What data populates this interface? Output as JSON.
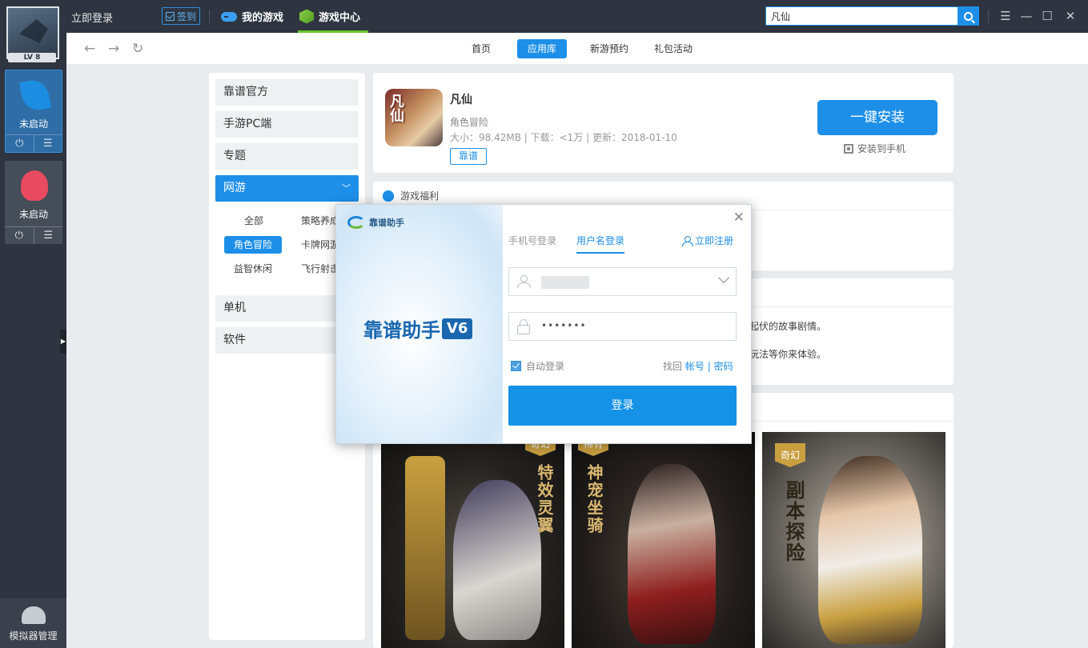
{
  "topbar": {
    "login_link": "立即登录",
    "signin_label": "签到",
    "tab_my_games": "我的游戏",
    "tab_game_center": "游戏中心",
    "search_value": "凡仙",
    "window_buttons": [
      "skin-icon",
      "menu-icon",
      "minimize-icon",
      "maximize-icon",
      "close-icon"
    ]
  },
  "dock": {
    "level": "LV 8",
    "emulators": [
      {
        "status": "未启动",
        "icon": "leaf-icon",
        "color": "#1c8de0"
      },
      {
        "status": "未启动",
        "icon": "bug-icon",
        "color": "#e84a5f"
      }
    ],
    "sim_manager": "模拟器管理"
  },
  "nav": {
    "tabs": [
      "首页",
      "应用库",
      "新游预约",
      "礼包活动"
    ],
    "active_tab": "应用库"
  },
  "categories": {
    "items": [
      "靠谱官方",
      "手游PC端",
      "专题",
      "网游",
      "单机",
      "软件"
    ],
    "active": "网游",
    "subcategories": [
      "全部",
      "策略养成",
      "角色冒险",
      "卡牌网游",
      "益智休闲",
      "飞行射击"
    ],
    "active_sub": "角色冒险"
  },
  "game": {
    "title": "凡仙",
    "icon_text": "凡仙",
    "genre": "角色冒险",
    "meta": "大小：98.42MB | 下载：<1万 | 更新：2018-01-10",
    "tag": "靠谱",
    "install_label": "一键安装",
    "install_to_phone": "安装到手机"
  },
  "benefits": {
    "title": "游戏福利"
  },
  "intro": {
    "line1": "起伏的故事剧情。",
    "line2": "玩法等你来体验。"
  },
  "screenshots": [
    {
      "badge": "奇幻",
      "caption": "特效灵翼"
    },
    {
      "badge": "稀有",
      "caption": "神宠坐骑"
    },
    {
      "badge": "奇幻",
      "caption": "副本探险"
    }
  ],
  "dialog": {
    "brand": "靠谱助手",
    "product": "靠谱助手",
    "version": "V6",
    "tab_phone": "手机号登录",
    "tab_username": "用户名登录",
    "register": "立即注册",
    "password_dots": "•••••••",
    "auto_login": "自动登录",
    "recover_prefix": "找回",
    "recover_account": "帐号",
    "recover_sep": "|",
    "recover_password": "密码",
    "login_button": "登录"
  },
  "colors": {
    "accent": "#1d8fe8",
    "topbar": "#2e3540",
    "active_underline": "#6bc431"
  }
}
